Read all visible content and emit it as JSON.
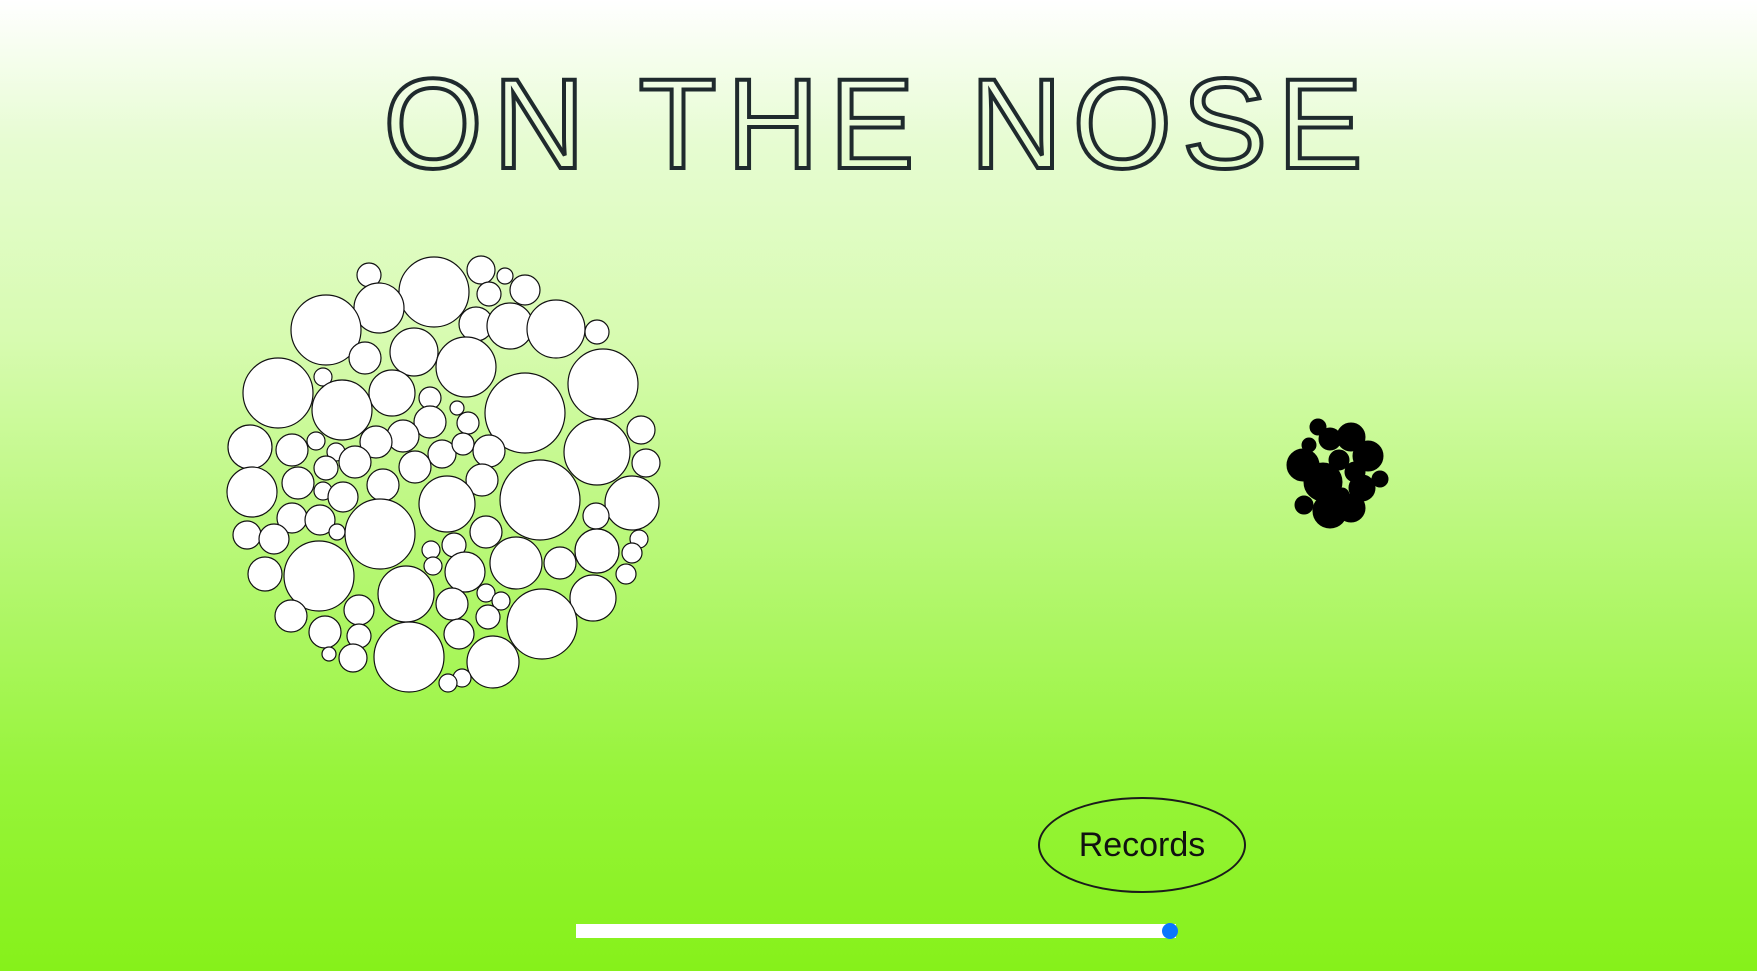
{
  "app": {
    "title": "ON THE NOSE"
  },
  "colors": {
    "title": "#1f2a2d",
    "bubble_fill": "#ffffff",
    "bubble_stroke": "#111111",
    "cluster_fill": "#000000",
    "accent": "#0a76ff"
  },
  "records_button": {
    "label": "Records"
  },
  "progress": {
    "value": 0.99
  }
}
